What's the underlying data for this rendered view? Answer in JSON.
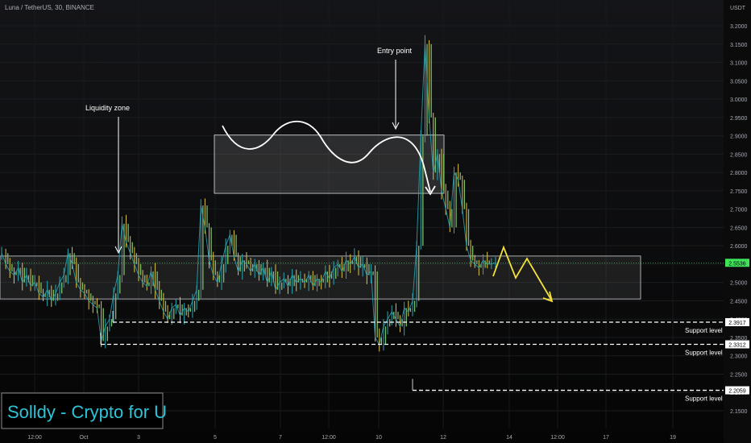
{
  "header": {
    "symbol_line": "Luna / TetherUS, 30, BINANCE"
  },
  "axis_right": {
    "unit_label": "USDT"
  },
  "watermark": {
    "text": "Solldy - Crypto for U"
  },
  "colors": {
    "candle_up": "#2aa7b4",
    "candle_down": "#e0c247",
    "candle_mid": "#7fbf6c",
    "annotation_white": "#ffffff",
    "annotation_yellow": "#f5e23a",
    "price_badge": "#3fe35a",
    "zone_fill": "#ffffff"
  },
  "chart_data": {
    "type": "line",
    "title": "",
    "xlabel": "",
    "ylabel": "",
    "x_ticks": [
      "12:00",
      "Oct",
      "3",
      "5",
      "7",
      "12:00",
      "10",
      "12",
      "14",
      "12:00",
      "17",
      "19"
    ],
    "ylim": [
      2.12,
      3.22
    ],
    "y_ticks": [
      "3.2000",
      "3.1500",
      "3.1000",
      "3.0500",
      "3.0000",
      "2.9500",
      "2.9000",
      "2.8500",
      "2.8000",
      "2.7500",
      "2.7000",
      "2.6500",
      "2.6000",
      "2.5500",
      "2.5000",
      "2.4500",
      "2.4000",
      "2.3500",
      "2.3000",
      "2.2500",
      "2.2000",
      "2.1500"
    ],
    "current_price": "2.5536",
    "series": [
      {
        "values": [
          2.58,
          2.55,
          2.53,
          2.52,
          2.54,
          2.5,
          2.52,
          2.49,
          2.5,
          2.47,
          2.46,
          2.48,
          2.45,
          2.47,
          2.5,
          2.52,
          2.58,
          2.55,
          2.5,
          2.48,
          2.47,
          2.45,
          2.44,
          2.43,
          2.34,
          2.38,
          2.4,
          2.47,
          2.52,
          2.66,
          2.61,
          2.58,
          2.55,
          2.52,
          2.5,
          2.49,
          2.53,
          2.48,
          2.45,
          2.42,
          2.4,
          2.43,
          2.44,
          2.41,
          2.43,
          2.42,
          2.45,
          2.48,
          2.71,
          2.65,
          2.56,
          2.52,
          2.5,
          2.55,
          2.6,
          2.63,
          2.57,
          2.53,
          2.56,
          2.55,
          2.53,
          2.55,
          2.52,
          2.54,
          2.5,
          2.53,
          2.48,
          2.5,
          2.51,
          2.49,
          2.52,
          2.5,
          2.51,
          2.5,
          2.52,
          2.49,
          2.51,
          2.5,
          2.53,
          2.51,
          2.54,
          2.55,
          2.53,
          2.56,
          2.55,
          2.57,
          2.54,
          2.55,
          2.52,
          2.53,
          2.35,
          2.33,
          2.38,
          2.4,
          2.42,
          2.4,
          2.38,
          2.43,
          2.42,
          2.45,
          2.6,
          2.9,
          3.15,
          2.95,
          2.8,
          2.85,
          2.75,
          2.7,
          2.65,
          2.8,
          2.78,
          2.7,
          2.6,
          2.56,
          2.55,
          2.54,
          2.56,
          2.55,
          2.55,
          2.5536
        ]
      }
    ],
    "horizontal_levels": [
      {
        "price": 2.3917,
        "badge": "2.3917",
        "label": "Support level"
      },
      {
        "price": 2.3312,
        "badge": "2.3312",
        "label": "Support level"
      },
      {
        "price": 2.2059,
        "badge": "2.2059",
        "label": "Support level"
      }
    ],
    "annotations": [
      {
        "text": "Liquidity zone"
      },
      {
        "text": "Entry point"
      }
    ]
  }
}
